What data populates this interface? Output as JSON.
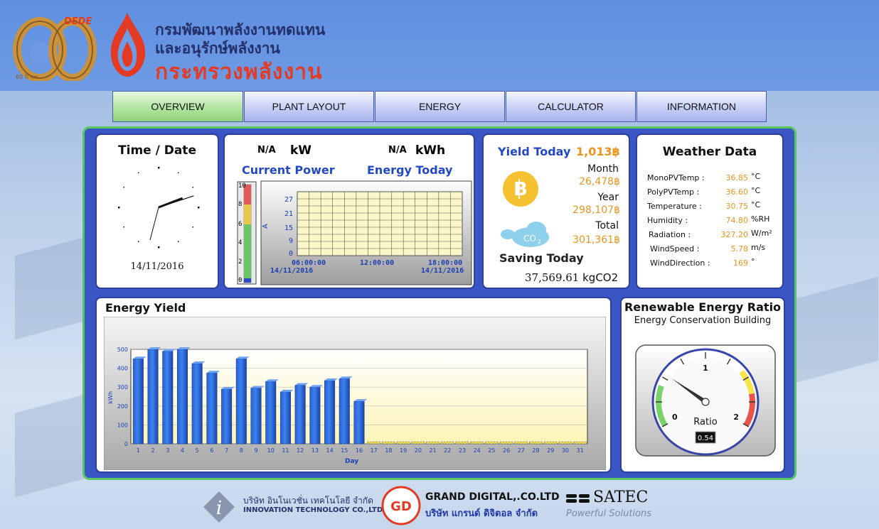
{
  "header": {
    "logo_text": "DEDE",
    "logo_sub": "60 ปี พพ.",
    "dept_line1": "กรมพัฒนาพลังงานทดแทน",
    "dept_line2": "และอนุรักษ์พลังงาน",
    "ministry": "กระทรวงพลังงาน"
  },
  "nav": {
    "tabs": [
      {
        "label": "OVERVIEW",
        "active": true
      },
      {
        "label": "PLANT LAYOUT",
        "active": false
      },
      {
        "label": "ENERGY",
        "active": false
      },
      {
        "label": "CALCULATOR",
        "active": false
      },
      {
        "label": "INFORMATION",
        "active": false
      }
    ]
  },
  "time_card": {
    "title": "Time / Date",
    "date": "14/11/2016",
    "clock_hour": 2.3,
    "clock_minute": 11
  },
  "power_card": {
    "power_value": "N/A",
    "power_unit": "kW",
    "energy_value": "N/A",
    "energy_unit": "kWh",
    "power_label": "Current Power",
    "energy_label": "Energy Today",
    "gauge_ticks": [
      "10",
      "8",
      "6",
      "4",
      "2",
      "0"
    ],
    "mini_chart": {
      "y_ticks": [
        "27",
        "21",
        "15",
        "9",
        "0"
      ],
      "y_axis": "A",
      "x_labels": [
        "06:00:00",
        "12:00:00",
        "18:00:00"
      ],
      "date_left": "14/11/2016",
      "date_right": "14/11/2016"
    }
  },
  "yield_card": {
    "title": "Yield Today",
    "today": "1,013",
    "currency": "฿",
    "month_label": "Month",
    "month": "26,478",
    "year_label": "Year",
    "year": "298,107",
    "total_label": "Total",
    "total": "301,361",
    "co2_label": "CO",
    "co2_sub": "2",
    "saving_label": "Saving Today",
    "saving_value": "37,569.61",
    "saving_unit": "kgCO2"
  },
  "weather_card": {
    "title": "Weather Data",
    "rows": [
      {
        "label": "MonoPVTemp :",
        "value": "36.85",
        "unit": "°C"
      },
      {
        "label": "PolyPVTemp :",
        "value": "36.60",
        "unit": "°C"
      },
      {
        "label": "Temperature :",
        "value": "30.75",
        "unit": "°C"
      },
      {
        "label": "Humidity :",
        "value": "74.80",
        "unit": "%RH"
      },
      {
        "label": "Radiation :",
        "value": "327.20",
        "unit": "W/m²"
      },
      {
        "label": "WindSpeed :",
        "value": "5.78",
        "unit": "m/s"
      },
      {
        "label": "WindDirection :",
        "value": "169",
        "unit": "°"
      }
    ]
  },
  "energy_yield": {
    "title": "Energy Yield"
  },
  "chart_data": {
    "type": "bar",
    "title": "",
    "xlabel": "Day",
    "ylabel": "kWh",
    "ylim": [
      0,
      500
    ],
    "yticks": [
      "500",
      "400",
      "300",
      "200",
      "100",
      "0"
    ],
    "categories": [
      "1",
      "2",
      "3",
      "4",
      "5",
      "6",
      "7",
      "8",
      "9",
      "10",
      "11",
      "12",
      "13",
      "14",
      "15",
      "16",
      "17",
      "18",
      "19",
      "20",
      "21",
      "22",
      "23",
      "24",
      "25",
      "26",
      "27",
      "28",
      "29",
      "30",
      "31"
    ],
    "values": [
      450,
      500,
      490,
      500,
      425,
      375,
      290,
      450,
      295,
      330,
      275,
      310,
      300,
      335,
      345,
      225,
      0,
      0,
      0,
      0,
      0,
      0,
      0,
      0,
      0,
      0,
      0,
      0,
      0,
      0,
      0
    ],
    "grid": true,
    "bar_color": "#2f6fe0"
  },
  "ratio_card": {
    "title": "Renewable Energy Ratio",
    "subtitle": "Energy Conservation Building",
    "gauge_label": "Ratio",
    "min": "0",
    "mid": "1",
    "max": "2",
    "value": 0.54,
    "value_text": "0.54"
  },
  "footer": {
    "inno_th": "บริษัท อินโนเวชั่น เทคโนโลยี จำกัด",
    "inno_en": "INNOVATION TECHNOLOGY CO.,LTD.",
    "gd_mark": "GD",
    "grand_en": "GRAND DIGITAL,.CO.LTD",
    "grand_th": "บริษัท แกรนด์ ดิจิตอล จำกัด",
    "satec": "SATEC",
    "satec_tag": "Powerful Solutions"
  },
  "colors": {
    "header": "#6a97e3",
    "main": "#3a55c4",
    "accent_orange": "#e8961e",
    "title_blue": "#2348c6"
  }
}
